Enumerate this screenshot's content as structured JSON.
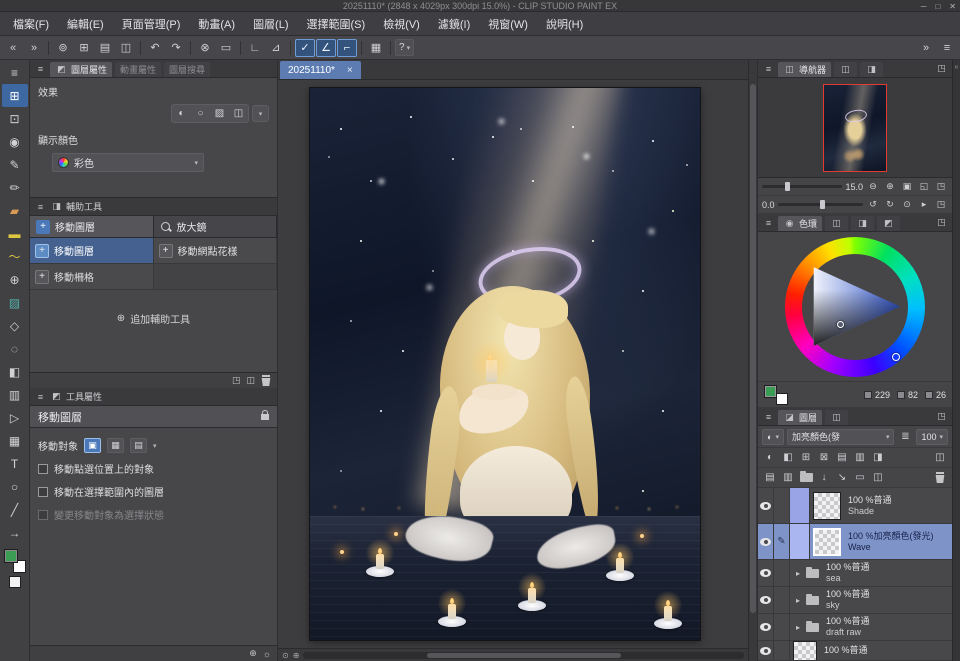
{
  "titlebar": {
    "title": "20251110* (2848 x 4029px 300dpi 15.0%) - CLIP STUDIO PAINT EX",
    "minimize": "─",
    "maximize": "□",
    "close": "✕"
  },
  "menubar": {
    "items": [
      "檔案(F)",
      "編輯(E)",
      "頁面管理(P)",
      "動畫(A)",
      "圖層(L)",
      "選擇範圍(S)",
      "檢視(V)",
      "濾鏡(I)",
      "視窗(W)",
      "說明(H)"
    ]
  },
  "icons": {
    "menu": "≡",
    "caret": "▾",
    "collapse_left": "«",
    "collapse_right": "»",
    "corner": "◳",
    "add": "⊕",
    "plus": "+",
    "zoom_out": "⊖",
    "zoom_in": "⊕",
    "fit": "▣",
    "orig": "◱",
    "rot_ccw": "↺",
    "rot_cw": "↻",
    "reset": "⊙",
    "step": "▸",
    "help": "?",
    "bar": "≣",
    "panel": "◫",
    "wheel_tab": "◉",
    "layers_tab": "◪",
    "prop_tab": "◩",
    "nav_tab": "◫",
    "subtool_tab": "◨",
    "effect1": "◐",
    "effect2": "○",
    "effect3": "▨",
    "effect4": "◫",
    "target1": "▣",
    "target2": "▦",
    "target3": "▤",
    "h_icon": "",
    "footer_gear": "☼",
    "mini1": "⊙",
    "mini2": "⊕"
  },
  "toolbar": {
    "icons": [
      {
        "name": "navigate",
        "glyph": "⊚"
      },
      {
        "name": "object-select",
        "glyph": "⊞"
      },
      {
        "name": "open-file",
        "glyph": "▤"
      },
      {
        "name": "save-file",
        "glyph": "◫"
      },
      {
        "name": "undo",
        "glyph": "↶"
      },
      {
        "name": "redo",
        "glyph": "↷"
      },
      {
        "name": "deselect",
        "glyph": "⊗"
      },
      {
        "name": "fill-rect",
        "glyph": "▭"
      },
      {
        "name": "snap-ruler",
        "glyph": "∟"
      },
      {
        "name": "snap-perspective",
        "glyph": "⊿"
      },
      {
        "name": "snap-check",
        "glyph": "✓"
      },
      {
        "name": "snap-angle",
        "glyph": "∠"
      },
      {
        "name": "snap-grid",
        "glyph": "⌐"
      },
      {
        "name": "grid-view",
        "glyph": "▦"
      }
    ]
  },
  "toolstrip": {
    "items": [
      {
        "name": "palette-menu",
        "glyph": "≡"
      },
      {
        "name": "tool-move-layer",
        "glyph": "⊞"
      },
      {
        "name": "tool-operate",
        "glyph": "⊡"
      },
      {
        "name": "tool-eyedropper",
        "glyph": "◉"
      },
      {
        "name": "tool-pen",
        "glyph": "✎"
      },
      {
        "name": "tool-pencil",
        "glyph": "✏"
      },
      {
        "name": "tool-brush",
        "glyph": "▰"
      },
      {
        "name": "tool-marker",
        "glyph": "▬"
      },
      {
        "name": "tool-curve",
        "glyph": "～"
      },
      {
        "name": "tool-airbrush",
        "glyph": "⊕"
      },
      {
        "name": "tool-decoration",
        "glyph": "▨"
      },
      {
        "name": "tool-eraser",
        "glyph": "◇"
      },
      {
        "name": "tool-blend",
        "glyph": "◌"
      },
      {
        "name": "tool-fill",
        "glyph": "◧"
      },
      {
        "name": "tool-gradient",
        "glyph": "▥"
      },
      {
        "name": "tool-figure",
        "glyph": "▷"
      },
      {
        "name": "tool-frame",
        "glyph": "▦"
      },
      {
        "name": "tool-text",
        "glyph": "T"
      },
      {
        "name": "tool-balloon",
        "glyph": "○"
      },
      {
        "name": "tool-line-correct",
        "glyph": "╱"
      },
      {
        "name": "tool-flow",
        "glyph": "→"
      }
    ]
  },
  "layerprop": {
    "tab": "圖層屬性",
    "tab2": "動畫屬性",
    "tab3": "圖層搜尋",
    "effect_label": "效果",
    "display_color_label": "顯示顏色",
    "color_mode": "彩色"
  },
  "subtool": {
    "title": "輔助工具",
    "group_move": "移動圖層",
    "group_zoom": "放大鏡",
    "items": [
      "移動圖層",
      "移動網點花樣",
      "移動柵格"
    ],
    "add_label": "追加輔助工具"
  },
  "toolprop": {
    "title": "工具屬性",
    "tool_name": "移動圖層",
    "target_label": "移動對象",
    "checks": [
      "移動點選位置上的對象",
      "移動在選擇範圍內的圖層",
      "變更移動對象為選擇狀態"
    ]
  },
  "canvas": {
    "tab": "20251110*",
    "close": "×"
  },
  "navigator": {
    "title": "導航器",
    "zoom": "15.0",
    "rotation": "0.0"
  },
  "color": {
    "title": "色環",
    "h": "229",
    "s": "82",
    "v": "26"
  },
  "layers": {
    "title": "圖層",
    "blend": "加亮顏色(發",
    "opacity": "100",
    "toggle_icons": [
      "◐",
      "◧",
      "⊞",
      "⊠",
      "▤",
      "▥",
      "◨"
    ],
    "new_icons": [
      "▤",
      "▥",
      "↓",
      "↘",
      "▭",
      "◫"
    ],
    "rows": [
      {
        "mode": "100 %普通",
        "name": "Shade"
      },
      {
        "mode": "100 %加亮顏色(發光)",
        "name": "Wave"
      },
      {
        "mode": "100 %普通",
        "name": "sea"
      },
      {
        "mode": "100 %普通",
        "name": "sky"
      },
      {
        "mode": "100 %普通",
        "name": "draft raw"
      },
      {
        "mode": "100 %普通",
        "name": ""
      }
    ]
  }
}
